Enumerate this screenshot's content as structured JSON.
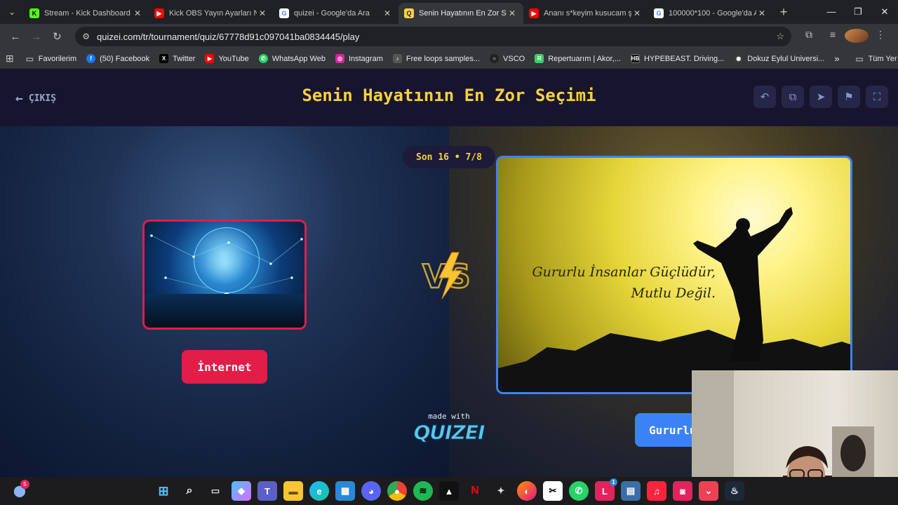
{
  "browser": {
    "tabs": [
      {
        "title": "Stream - Kick Dashboard",
        "icon": "kick-icon",
        "color": "#53fc18",
        "active": false
      },
      {
        "title": "Kick OBS Yayın Ayarları Na",
        "icon": "youtube-icon",
        "color": "#ff0000",
        "active": false
      },
      {
        "title": "quizei - Google'da Ara",
        "icon": "google-icon",
        "color": "#4285f4",
        "active": false
      },
      {
        "title": "Senin Hayatının En Zor Seç",
        "icon": "quizei-icon",
        "color": "#f7d23a",
        "active": true
      },
      {
        "title": "Ananı s*keyim kusucam şi",
        "icon": "youtube-icon",
        "color": "#ff0000",
        "active": false
      },
      {
        "title": "100000*100 - Google'da A",
        "icon": "google-icon",
        "color": "#4285f4",
        "active": false
      }
    ],
    "url": "quizei.com/tr/tournament/quiz/67778d91c097041ba0834445/play",
    "bookmarks": [
      {
        "label": "Favorilerim",
        "icon": "folder-icon",
        "color": "#9aa0a6"
      },
      {
        "label": "(50) Facebook",
        "icon": "facebook-icon",
        "color": "#1877f2"
      },
      {
        "label": "Twitter",
        "icon": "x-icon",
        "color": "#000000"
      },
      {
        "label": "YouTube",
        "icon": "youtube-icon",
        "color": "#ff0000"
      },
      {
        "label": "WhatsApp Web",
        "icon": "whatsapp-icon",
        "color": "#25d366"
      },
      {
        "label": "Instagram",
        "icon": "instagram-icon",
        "color": "#d6249f"
      },
      {
        "label": "Free loops samples...",
        "icon": "loops-icon",
        "color": "#555555"
      },
      {
        "label": "VSCO",
        "icon": "vsco-icon",
        "color": "#222222"
      },
      {
        "label": "Repertuarım | Akor,...",
        "icon": "repertuar-icon",
        "color": "#3ccf6a"
      },
      {
        "label": "HYPEBEAST. Driving...",
        "icon": "hypebeast-icon",
        "color": "#111111"
      },
      {
        "label": "Dokuz Eylul Universi...",
        "icon": "university-icon",
        "color": "#3a3a3a"
      }
    ],
    "all_bookmarks": "Tüm Yer İşaretleri"
  },
  "quiz": {
    "exit_label": "ÇIKIŞ",
    "title": "Senin Hayatının En Zor Seçimi",
    "round": "Son 16 • 7/8",
    "left_option": "İnternet",
    "right_option": "Gururlu",
    "right_quote_line1": "Gururlu İnsanlar Güçlüdür,",
    "right_quote_line2": "Mutlu Değil.",
    "made_with": "made with",
    "brand": "QUIZEI",
    "colors": {
      "title": "#f7d23a",
      "left": "#e11d48",
      "right": "#3b82f6"
    }
  },
  "taskbar": {
    "notification_count": "5",
    "steam_badge": "1"
  }
}
